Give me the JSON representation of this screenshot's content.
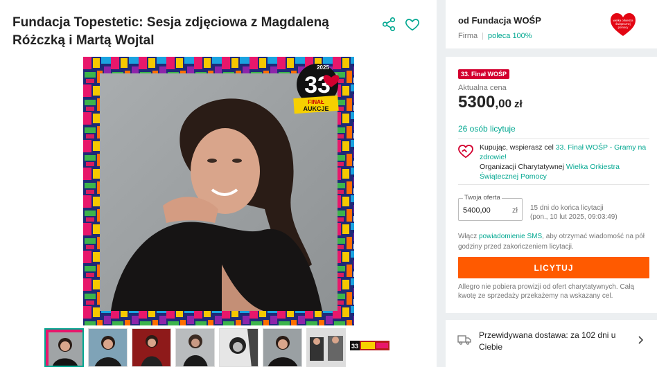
{
  "product": {
    "title": "Fundacja Topestetic: Sesja zdjęciowa z Magdaleną Różczką i Martą Wojtal",
    "share_icon": "share-icon",
    "favorite_icon": "heart-outline-icon"
  },
  "image": {
    "badge_number": "33",
    "badge_year": "2025",
    "badge_line1": "FINAŁ",
    "badge_line2": "AUKCJE",
    "heart_text": "wielka orkiestra świątecznej pomocy"
  },
  "thumbnails": [
    {
      "label": "photo-1"
    },
    {
      "label": "photo-2"
    },
    {
      "label": "photo-3"
    },
    {
      "label": "photo-4"
    },
    {
      "label": "photo-5"
    },
    {
      "label": "photo-6"
    },
    {
      "label": "photo-7"
    },
    {
      "label": "photo-8"
    }
  ],
  "seller": {
    "name": "od Fundacja WOŚP",
    "type": "Firma",
    "rating": "poleca 100%",
    "logo_text": "wielka orkiestra świątecznej pomocy"
  },
  "offer": {
    "badge": "33. Finał WOŚP",
    "price_label": "Aktualna cena",
    "price_main": "5300",
    "price_cents": ",00",
    "currency": "zł",
    "bidders": "26 osób licytuje",
    "charity_prefix": "Kupując, wspierasz cel ",
    "charity_goal": "33. Finał WOŚP - Gramy na zdrowie!",
    "charity_org_prefix": "Organizacji Charytatywnej ",
    "charity_org": "Wielka Orkiestra Świątecznej Pomocy",
    "bid_label": "Twoja oferta",
    "bid_value": "5400,00",
    "bid_unit": "zł",
    "time_left": "15 dni do końca licytacji",
    "end_date": "(pon., 10 lut 2025, 09:03:49)",
    "sms_prefix": "Włącz ",
    "sms_link": "powiadomienie SMS",
    "sms_suffix": ", aby otrzymać wiadomość na pół godziny przed zakończeniem licytacji.",
    "bid_button": "LICYTUJ",
    "note": "Allegro nie pobiera prowizji od ofert charytatywnych. Całą kwotę ze sprzedaży przekażemy na wskazany cel."
  },
  "delivery": {
    "text": "Przewidywana dostawa: za 102 dni u Ciebie",
    "icon": "truck-icon"
  },
  "colors": {
    "accent": "#00a790",
    "button": "#ff5a00",
    "badge": "#d3002f"
  }
}
